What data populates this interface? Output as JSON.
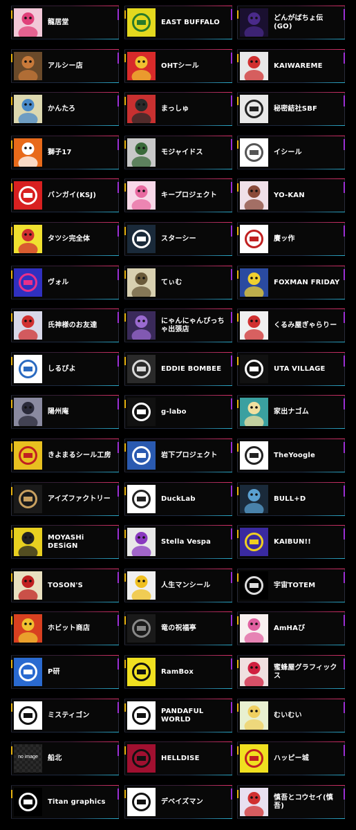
{
  "items": [
    {
      "name": "龍居堂",
      "thumb": "anime-girl-pink",
      "bg": "#f2c8d8",
      "fg": "#e0407a"
    },
    {
      "name": "EAST BUFFALO",
      "thumb": "buffalo-logo",
      "bg": "#e4d81e",
      "fg": "#2a7a2a"
    },
    {
      "name": "どんがばちょ伝(GO)",
      "thumb": "demon-face",
      "bg": "#1a1030",
      "fg": "#4a2a8a"
    },
    {
      "name": "アルシー店",
      "thumb": "warrior-character",
      "bg": "#6a4a2a",
      "fg": "#c87a3a"
    },
    {
      "name": "OHTシール",
      "thumb": "collage-sticker",
      "bg": "#d82a2a",
      "fg": "#f0c030"
    },
    {
      "name": "KAIWAREME",
      "thumb": "sticker-character",
      "bg": "#e8e8e8",
      "fg": "#d03030"
    },
    {
      "name": "かんたろ",
      "thumb": "character-sticker",
      "bg": "#dcd8b0",
      "fg": "#4a8ac8"
    },
    {
      "name": "まっしゅ",
      "thumb": "collage-sticker",
      "bg": "#c83030",
      "fg": "#2a2a2a"
    },
    {
      "name": "秘密結社SBF",
      "thumb": "text-logo",
      "bg": "#e8e8e8",
      "fg": "#222222"
    },
    {
      "name": "獅子17",
      "thumb": "lion-sticker",
      "bg": "#e86a1a",
      "fg": "#ffffff"
    },
    {
      "name": "モジャイドス",
      "thumb": "monster-sketch",
      "bg": "#c8c8c8",
      "fg": "#3a6a3a"
    },
    {
      "name": "イシール",
      "thumb": "cube-logo",
      "bg": "#ffffff",
      "fg": "#555555"
    },
    {
      "name": "バンガイ(KSJ)",
      "thumb": "text-logo",
      "bg": "#d82020",
      "fg": "#ffffff"
    },
    {
      "name": "キープロジェクト",
      "thumb": "anime-girl-pink",
      "bg": "#f8d8e8",
      "fg": "#e86aa0"
    },
    {
      "name": "YO-KAN",
      "thumb": "anime-girl-brown",
      "bg": "#f0e0e8",
      "fg": "#8a4a3a"
    },
    {
      "name": "タツシ完全体",
      "thumb": "colorful-sticker",
      "bg": "#f0e030",
      "fg": "#d03030"
    },
    {
      "name": "スターシー",
      "thumb": "line-logo",
      "bg": "#1a2a3a",
      "fg": "#ffffff"
    },
    {
      "name": "賡ッ作",
      "thumb": "text-logo",
      "bg": "#ffffff",
      "fg": "#c02020"
    },
    {
      "name": "ヴォル",
      "thumb": "v-logo",
      "bg": "#3030c0",
      "fg": "#e8308a"
    },
    {
      "name": "てぃむ",
      "thumb": "cat-photo",
      "bg": "#d8d0b0",
      "fg": "#6a5a3a"
    },
    {
      "name": "FOXMAN FRIDAY",
      "thumb": "anime-boy",
      "bg": "#2a4aa0",
      "fg": "#f0d030"
    },
    {
      "name": "氏神様のお友達",
      "thumb": "robot-character",
      "bg": "#d8d8e8",
      "fg": "#d03030"
    },
    {
      "name": "にゃんにゃんぴっちゃ出張店",
      "thumb": "purple-character",
      "bg": "#3a2a5a",
      "fg": "#9a6ad0"
    },
    {
      "name": "くるみ屋ぎゃらりー",
      "thumb": "red-character",
      "bg": "#f0f0f0",
      "fg": "#d03030"
    },
    {
      "name": "しるぴよ",
      "thumb": "bird-logo",
      "bg": "#ffffff",
      "fg": "#2a6ac0"
    },
    {
      "name": "EDDIE BOMBEE",
      "thumb": "sunburst-logo",
      "bg": "#2a2a2a",
      "fg": "#d8d8d8"
    },
    {
      "name": "UTA VILLAGE",
      "thumb": "text-logo",
      "bg": "#111111",
      "fg": "#ffffff"
    },
    {
      "name": "陽州庵",
      "thumb": "anime-girl-dark",
      "bg": "#8a8aa0",
      "fg": "#2a2a3a"
    },
    {
      "name": "g-labo",
      "thumb": "g-logo",
      "bg": "#111111",
      "fg": "#ffffff"
    },
    {
      "name": "家出ナゴム",
      "thumb": "flower-character",
      "bg": "#3aa0a0",
      "fg": "#f0e0a0"
    },
    {
      "name": "きよまるシール工房",
      "thumb": "red-circle-logo",
      "bg": "#e8c020",
      "fg": "#c02020"
    },
    {
      "name": "岩下プロジェクト",
      "thumb": "w-logo",
      "bg": "#2a5ab0",
      "fg": "#ffffff"
    },
    {
      "name": "TheYoogle",
      "thumb": "text-logo",
      "bg": "#ffffff",
      "fg": "#222222"
    },
    {
      "name": "アイズファクトリー",
      "thumb": "eyes-logo",
      "bg": "#1a1a1a",
      "fg": "#c8a060"
    },
    {
      "name": "DuckLab",
      "thumb": "duck-logo",
      "bg": "#ffffff",
      "fg": "#222222"
    },
    {
      "name": "BULL+D",
      "thumb": "anime-girl-blue",
      "bg": "#1a2a3a",
      "fg": "#5aa0d0"
    },
    {
      "name": "MOYASHi DESiGN",
      "thumb": "warrior-character",
      "bg": "#e8d020",
      "fg": "#222222"
    },
    {
      "name": "Stella Vespa",
      "thumb": "character-sticker",
      "bg": "#e8e8e8",
      "fg": "#8a3ac0"
    },
    {
      "name": "KAIBUN!!",
      "thumb": "kaibun-logo",
      "bg": "#3a2aa0",
      "fg": "#f0d020"
    },
    {
      "name": "TOSON'S",
      "thumb": "warrior-character",
      "bg": "#e8e0c0",
      "fg": "#c02020"
    },
    {
      "name": "人生マンシール",
      "thumb": "yellow-character",
      "bg": "#f0f0f0",
      "fg": "#f0c020"
    },
    {
      "name": "宇宙TOTEM",
      "thumb": "dotted-circle-logo",
      "bg": "#000000",
      "fg": "#dddddd"
    },
    {
      "name": "ホビット商店",
      "thumb": "fire-character",
      "bg": "#d84020",
      "fg": "#f0c030"
    },
    {
      "name": "竜の祝福亭",
      "thumb": "dark-emblem",
      "bg": "#1a1a1a",
      "fg": "#888888"
    },
    {
      "name": "AmHAび",
      "thumb": "pink-character",
      "bg": "#f8f0f0",
      "fg": "#e060a0"
    },
    {
      "name": "P研",
      "thumb": "p-logo",
      "bg": "#2a6ad0",
      "fg": "#ffffff"
    },
    {
      "name": "RamBox",
      "thumb": "rambox-logo",
      "bg": "#f0e020",
      "fg": "#111111"
    },
    {
      "name": "蜜蜂屋グラフィックス",
      "thumb": "red-character",
      "bg": "#f0e0e0",
      "fg": "#d02040"
    },
    {
      "name": "ミスティゴン",
      "thumb": "m-logo",
      "bg": "#ffffff",
      "fg": "#111111"
    },
    {
      "name": "PANDAFUL WORLD",
      "thumb": "panda-logo",
      "bg": "#ffffff",
      "fg": "#111111"
    },
    {
      "name": "むいむい",
      "thumb": "blonde-character",
      "bg": "#e8f0d0",
      "fg": "#f0d060"
    },
    {
      "name": "船北",
      "thumb": "no-image",
      "bg": "#1e1e1e",
      "fg": "#ffffff",
      "placeholder": "no image"
    },
    {
      "name": "HELLDISE",
      "thumb": "red-emblem",
      "bg": "#a01030",
      "fg": "#111111"
    },
    {
      "name": "ハッピー城",
      "thumb": "yellow-logo",
      "bg": "#f0e020",
      "fg": "#c02020"
    },
    {
      "name": "Titan graphics",
      "thumb": "titan-logo",
      "bg": "#000000",
      "fg": "#ffffff"
    },
    {
      "name": "デベイズマン",
      "thumb": "eye-logo",
      "bg": "#ffffff",
      "fg": "#111111"
    },
    {
      "name": "慎吾とコウセイ(慎吾)",
      "thumb": "colorful-sticker",
      "bg": "#e8e0f0",
      "fg": "#d03030"
    }
  ]
}
